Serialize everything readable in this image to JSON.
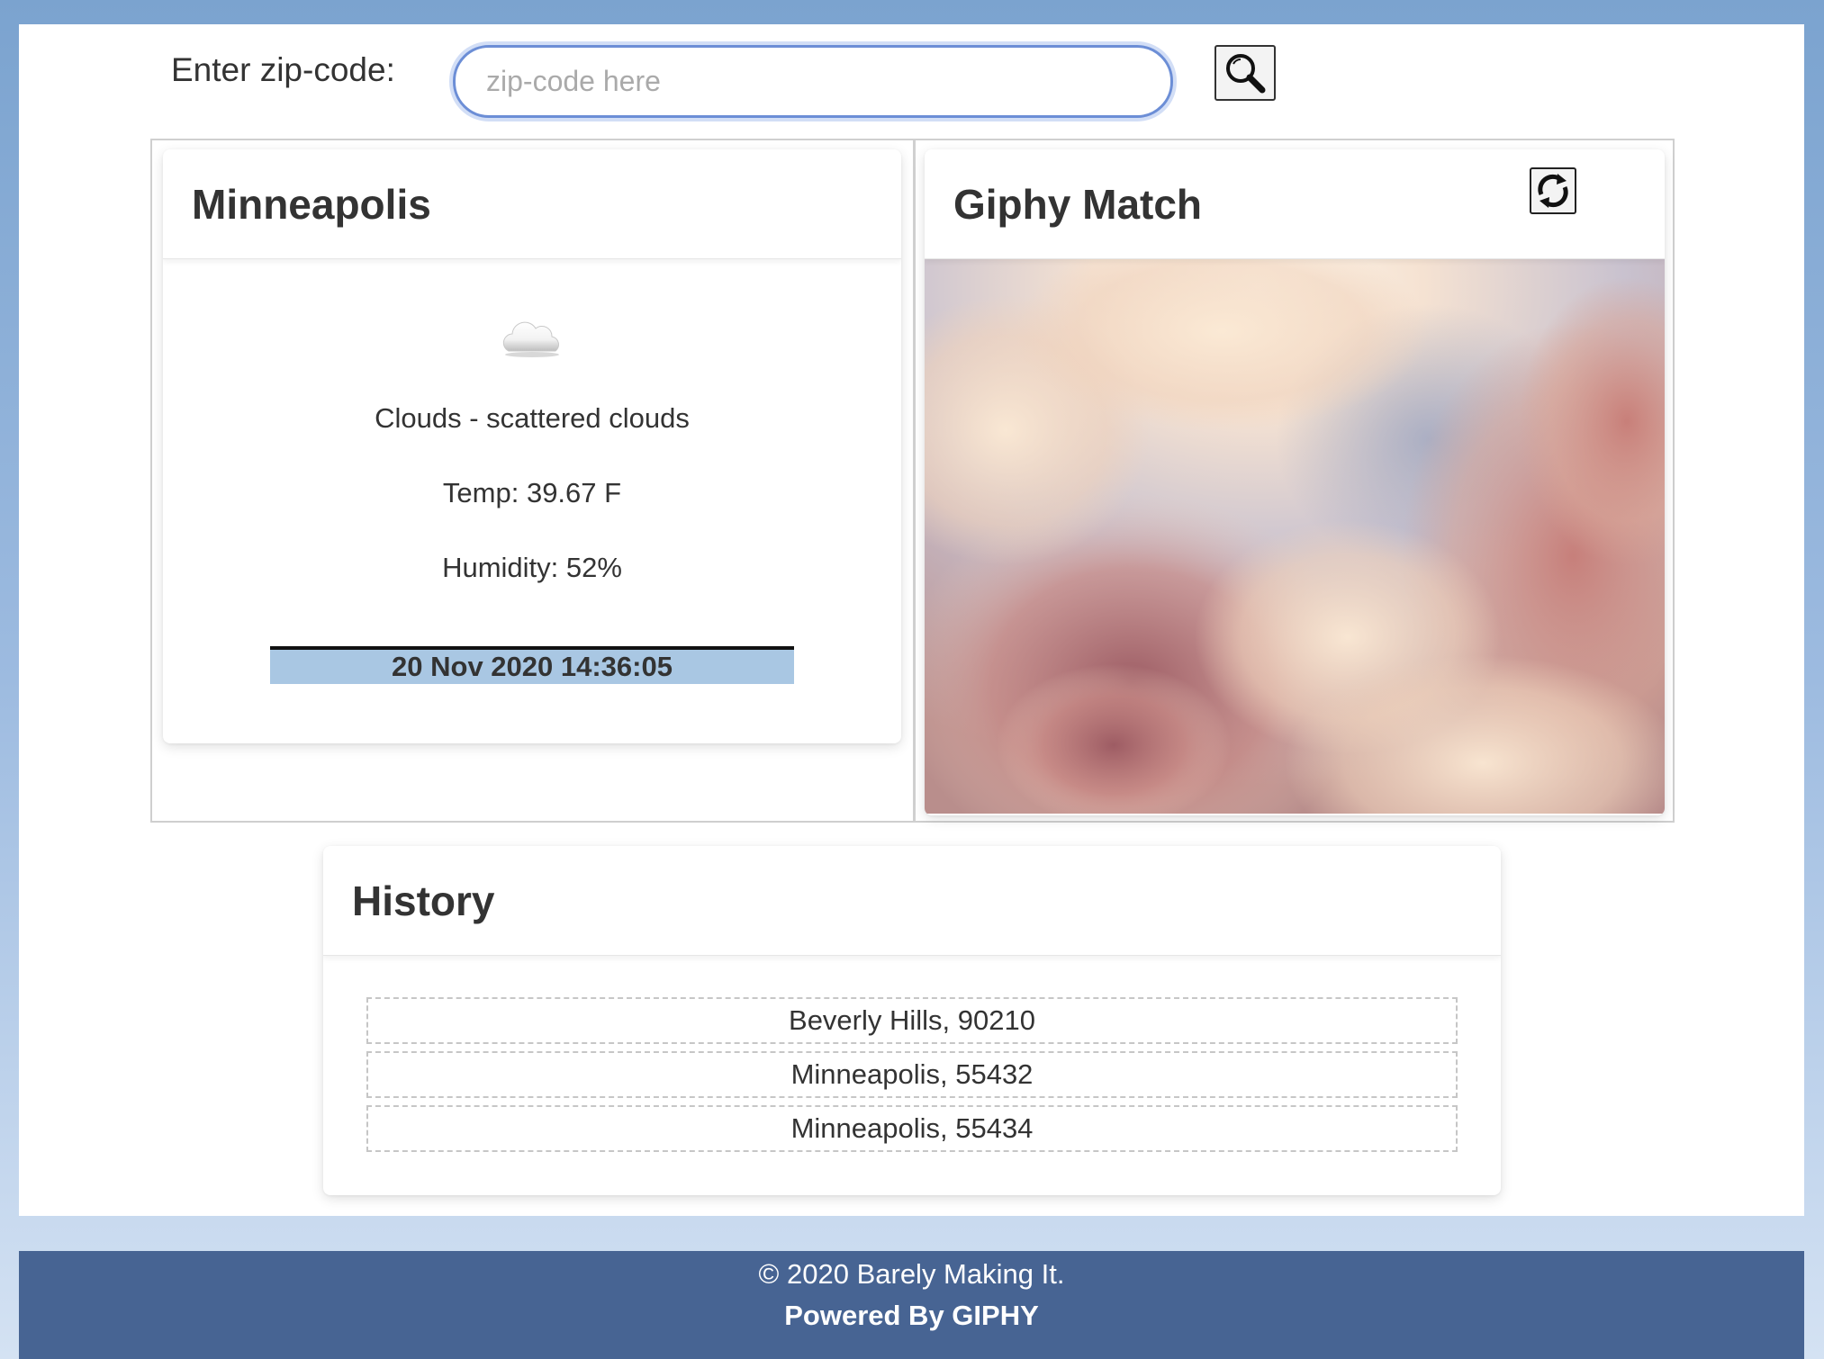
{
  "search": {
    "label": "Enter zip-code:",
    "placeholder": "zip-code here",
    "value": "",
    "button_icon": "search-icon"
  },
  "weather": {
    "city": "Minneapolis",
    "icon": "cloud-icon",
    "description": "Clouds - scattered clouds",
    "temp": "Temp: 39.67 F",
    "humidity": "Humidity: 52%",
    "datetime": "20 Nov 2020 14:36:05"
  },
  "giphy": {
    "title": "Giphy Match",
    "refresh_icon": "refresh-icon"
  },
  "history": {
    "title": "History",
    "items": [
      {
        "label": "Beverly Hills, 90210"
      },
      {
        "label": "Minneapolis, 55432"
      },
      {
        "label": "Minneapolis, 55434"
      }
    ]
  },
  "footer": {
    "copyright": "© 2020 Barely Making It.",
    "powered": "Powered By GIPHY"
  },
  "colors": {
    "footer_bg": "#476493",
    "date_bar": "#a9c7e3",
    "input_border": "#6c8ed6"
  }
}
